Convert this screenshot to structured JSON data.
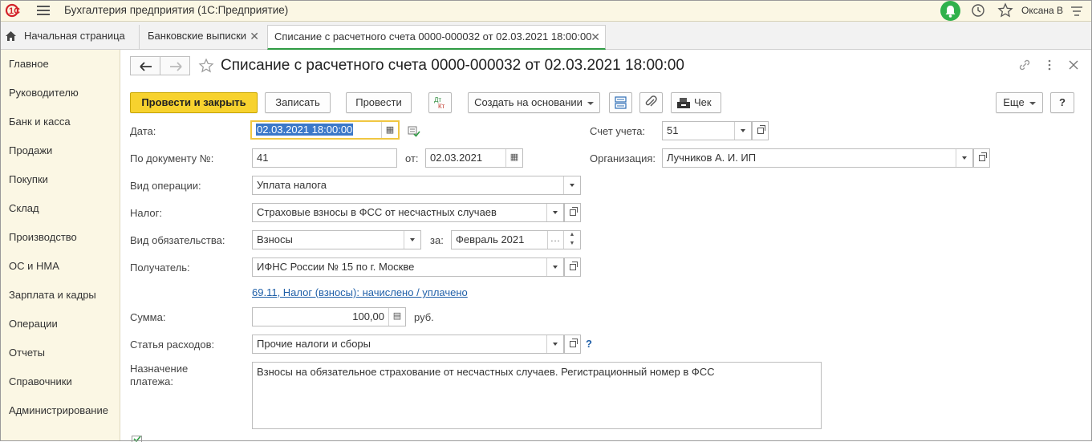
{
  "app": {
    "title": "Бухгалтерия предприятия  (1С:Предприятие)",
    "user": "Оксана В",
    "logo_text": "1С"
  },
  "tabs": {
    "home": "Начальная страница",
    "bank": "Банковские выписки",
    "active": "Списание с расчетного счета 0000-000032 от 02.03.2021 18:00:00",
    "close_glyph": "✕"
  },
  "sidebar": {
    "items": [
      {
        "label": "Главное"
      },
      {
        "label": "Руководителю"
      },
      {
        "label": "Банк и касса"
      },
      {
        "label": "Продажи"
      },
      {
        "label": "Покупки"
      },
      {
        "label": "Склад"
      },
      {
        "label": "Производство"
      },
      {
        "label": "ОС и НМА"
      },
      {
        "label": "Зарплата и кадры"
      },
      {
        "label": "Операции"
      },
      {
        "label": "Отчеты"
      },
      {
        "label": "Справочники"
      },
      {
        "label": "Администрирование"
      }
    ]
  },
  "document": {
    "title": "Списание с расчетного счета 0000-000032 от 02.03.2021 18:00:00"
  },
  "toolbar": {
    "post_close": "Провести и закрыть",
    "save": "Записать",
    "post": "Провести",
    "dt_kt": "Дт Кт",
    "create_based": "Создать на основании",
    "check": "Чек",
    "more": "Еще",
    "help": "?"
  },
  "form": {
    "date_label": "Дата:",
    "date_value": "02.03.2021 18:00:00",
    "account_label": "Счет учета:",
    "account_value": "51",
    "doc_no_label": "По документу №:",
    "doc_no_value": "41",
    "from_label": "от:",
    "from_value": "02.03.2021",
    "org_label": "Организация:",
    "org_value": "Лучников А. И. ИП",
    "op_label": "Вид операции:",
    "op_value": "Уплата налога",
    "tax_label": "Налог:",
    "tax_value": "Страховые взносы в ФСС от несчастных случаев",
    "obligation_label": "Вид обязательства:",
    "obligation_value": "Взносы",
    "for_label": "за:",
    "period_value": "Февраль 2021",
    "recipient_label": "Получатель:",
    "recipient_value": "ИФНС России № 15 по г. Москве",
    "account_link": "69.11, Налог (взносы): начислено / уплачено",
    "sum_label": "Сумма:",
    "sum_value": "100,00",
    "currency": "руб.",
    "expense_label": "Статья расходов:",
    "expense_value": "Прочие налоги и сборы",
    "help_mark": "?",
    "purpose_label_1": "Назначение",
    "purpose_label_2": "платежа:",
    "purpose_value": "Взносы на обязательное страхование от несчастных случаев. Регистрационный номер в ФСС"
  },
  "colors": {
    "accent_yellow": "#f7d22e",
    "active_tab_green": "#2e9b43",
    "link_blue": "#1f5fa8",
    "selection_blue": "#3b78c9",
    "sidebar_bg": "#fbf7e4"
  }
}
